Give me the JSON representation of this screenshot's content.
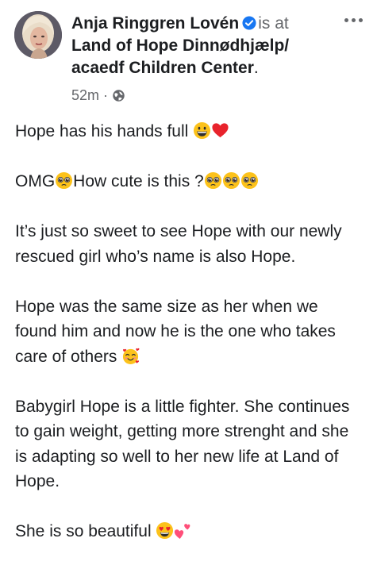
{
  "post": {
    "author": "Anja Ringgren Lovén",
    "is_at": "is at",
    "place": "Land of Hope Dinnødhjælp/ acaedf Children Center",
    "period": ".",
    "time": "52m",
    "dot": "·",
    "privacy_icon": "globe-icon",
    "more_icon": "more-options-icon",
    "paragraphs": {
      "p1": "Hope has his hands full ",
      "p2a": "OMG",
      "p2b": "How cute is this ?",
      "p3": "It’s just so sweet to see Hope with our newly rescued girl who’s name is also Hope.",
      "p4": "Hope was the same size as her when we found him and now he is the one who takes care of others ",
      "p5": "Babygirl Hope is a little fighter. She continues to gain weight, getting more strenght and she is adapting so well to her new life at Land of Hope.",
      "p6": "She is so beautiful "
    },
    "emojis": {
      "grinning": "grinning-face",
      "heart": "red-heart",
      "pleading": "pleading-face",
      "smiling_hearts": "smiling-face-with-hearts",
      "heart_eyes": "heart-eyes-face",
      "two_hearts": "two-hearts"
    },
    "colors": {
      "text": "#1c1e21",
      "secondary": "#65676b",
      "verified": "#1877f2"
    }
  }
}
